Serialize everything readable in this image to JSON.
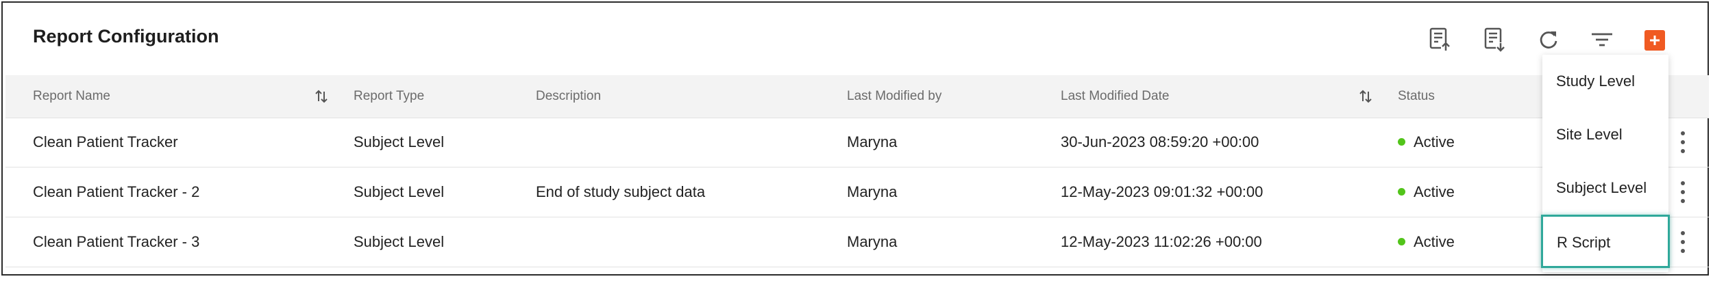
{
  "page": {
    "title": "Report Configuration"
  },
  "toolbar": {
    "icons": [
      "export-upload-icon",
      "export-download-icon",
      "refresh-icon",
      "filter-icon",
      "add-icon"
    ],
    "accent_color": "#f05a22"
  },
  "table": {
    "columns": {
      "report_name": "Report Name",
      "report_type": "Report Type",
      "description": "Description",
      "last_modified_by": "Last Modified by",
      "last_modified_date": "Last Modified Date",
      "status": "Status"
    },
    "rows": [
      {
        "report_name": "Clean Patient Tracker",
        "report_type": "Subject Level",
        "description": "",
        "last_modified_by": "Maryna",
        "last_modified_date": "30-Jun-2023 08:59:20 +00:00",
        "status": "Active"
      },
      {
        "report_name": "Clean Patient Tracker - 2",
        "report_type": "Subject Level",
        "description": "End of study subject data",
        "last_modified_by": "Maryna",
        "last_modified_date": "12-May-2023 09:01:32 +00:00",
        "status": "Active"
      },
      {
        "report_name": "Clean Patient Tracker - 3",
        "report_type": "Subject Level",
        "description": "",
        "last_modified_by": "Maryna",
        "last_modified_date": "12-May-2023 11:02:26 +00:00",
        "status": "Active"
      }
    ],
    "status_color": "#52c41a"
  },
  "add_menu": {
    "items": [
      "Study Level",
      "Site Level",
      "Subject Level",
      "R Script"
    ],
    "highlight_color": "#2fa89a"
  }
}
